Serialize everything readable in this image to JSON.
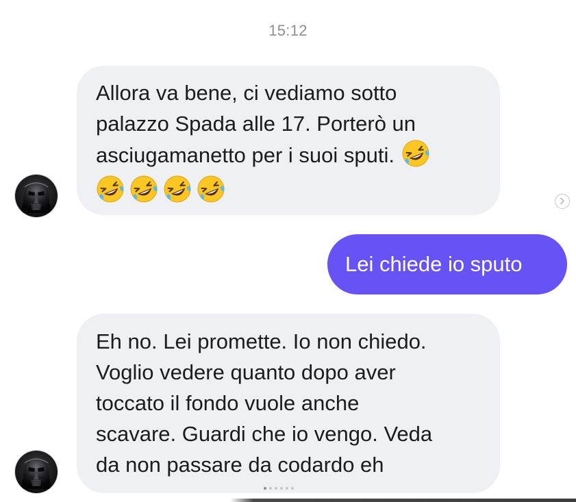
{
  "header": {
    "timestamp": "15:12"
  },
  "messages": [
    {
      "direction": "incoming",
      "text": "Allora va  bene, ci vediamo sotto\npalazzo Spada alle 17. Porterò un\nasciugamanetto per i suoi sputi.",
      "trailing_emoji": "rolling-on-floor-laughing",
      "emoji_row": [
        "rolling-on-floor-laughing",
        "rolling-on-floor-laughing",
        "rolling-on-floor-laughing",
        "rolling-on-floor-laughing"
      ]
    },
    {
      "direction": "outgoing",
      "text": "Lei chiede io sputo"
    },
    {
      "direction": "incoming",
      "text": "Eh no. Lei promette. Io non chiedo.\nVoglio vedere quanto dopo aver\ntoccato il fondo vuole anche\nscavare. Guardi che io vengo. Veda\nda non passare da codardo eh"
    }
  ],
  "avatar_icon": "darth-vader-avatar-icon",
  "forward_icon": "chevron-right-icon",
  "colors": {
    "incoming_bubble": "#eff0f3",
    "outgoing_bubble": "#6652f5",
    "text": "#1c1c1e",
    "timestamp": "#8e8e93"
  }
}
